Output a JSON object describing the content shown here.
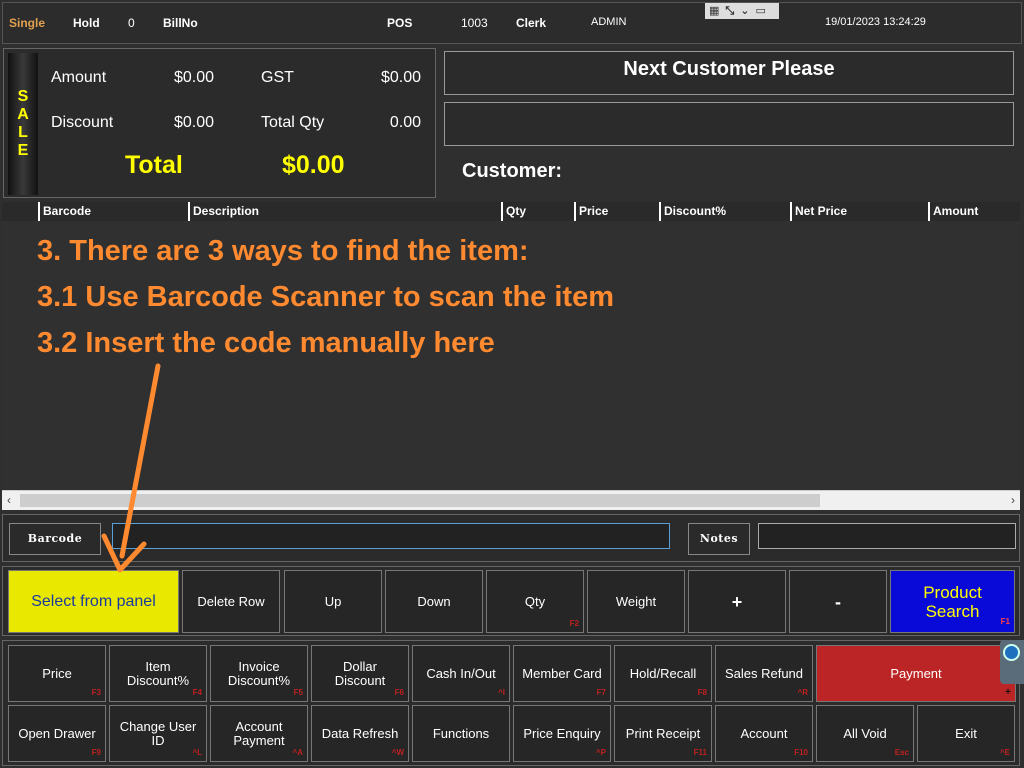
{
  "topbar": {
    "mode": "Single",
    "hold_label": "Hold",
    "hold_count": "0",
    "bill_label": "BillNo",
    "pos_label": "POS",
    "pos_number": "1003",
    "clerk_label": "Clerk",
    "clerk_name": "ADMIN",
    "datetime": "19/01/2023 13:24:29",
    "window_icons": [
      "grid-icon",
      "resize-icon",
      "chevron-down-icon",
      "monitor-icon"
    ]
  },
  "totals": {
    "sale_letters": [
      "S",
      "A",
      "L",
      "E"
    ],
    "amount_label": "Amount",
    "amount_value": "$0.00",
    "gst_label": "GST",
    "gst_value": "$0.00",
    "discount_label": "Discount",
    "discount_value": "$0.00",
    "total_qty_label": "Total Qty",
    "total_qty_value": "0.00",
    "total_label": "Total",
    "total_value": "$0.00"
  },
  "customer": {
    "message": "Next Customer Please",
    "secondary_message": "",
    "customer_label": "Customer:"
  },
  "grid": {
    "columns": [
      "Barcode",
      "Description",
      "Qty",
      "Price",
      "Discount%",
      "Net Price",
      "Amount"
    ]
  },
  "instructions": [
    "3. There are 3 ways to find the item:",
    "3.1 Use Barcode Scanner to scan the item",
    "3.2 Insert the code manually here"
  ],
  "input_row": {
    "barcode_button": "Barcode",
    "barcode_value": "",
    "notes_button": "Notes",
    "notes_value": ""
  },
  "action_row": [
    {
      "label": "Select from panel",
      "key": ""
    },
    {
      "label": "Delete Row",
      "key": ""
    },
    {
      "label": "Up",
      "key": ""
    },
    {
      "label": "Down",
      "key": ""
    },
    {
      "label": "Qty",
      "key": "F2"
    },
    {
      "label": "Weight",
      "key": ""
    },
    {
      "label": "+",
      "key": ""
    },
    {
      "label": "-",
      "key": ""
    },
    {
      "label": "Product Search",
      "key": "F1"
    }
  ],
  "function_row1": [
    {
      "label": "Price",
      "key": "F3"
    },
    {
      "label": "Item Discount%",
      "key": "F4"
    },
    {
      "label": "Invoice Discount%",
      "key": "F5"
    },
    {
      "label": "Dollar Discount",
      "key": "F6"
    },
    {
      "label": "Cash In/Out",
      "key": "^I"
    },
    {
      "label": "Member Card",
      "key": "F7"
    },
    {
      "label": "Hold/Recall",
      "key": "F8"
    },
    {
      "label": "Sales Refund",
      "key": "^R"
    },
    {
      "label": "Payment",
      "key": "+"
    }
  ],
  "function_row2": [
    {
      "label": "Open Drawer",
      "key": "F9"
    },
    {
      "label": "Change User ID",
      "key": "^L"
    },
    {
      "label": "Account Payment",
      "key": "^A"
    },
    {
      "label": "Data Refresh",
      "key": "^W"
    },
    {
      "label": "Functions",
      "key": ""
    },
    {
      "label": "Price Enquiry",
      "key": "^P"
    },
    {
      "label": "Print Receipt",
      "key": "F11"
    },
    {
      "label": "Account",
      "key": "F10"
    },
    {
      "label": "All Void",
      "key": "Esc"
    },
    {
      "label": "Exit",
      "key": "^E"
    }
  ]
}
